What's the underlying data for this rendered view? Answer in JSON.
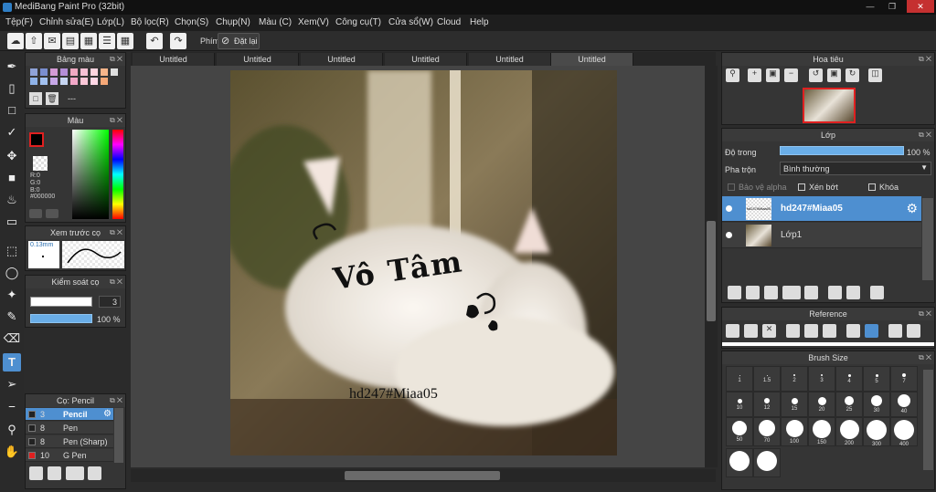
{
  "app": {
    "title": "MediBang Paint Pro (32bit)"
  },
  "menu": [
    "Tệp(F)",
    "Chỉnh sửa(E)",
    "Lớp(L)",
    "Bộ lọc(R)",
    "Chọn(S)",
    "Chụp(N)",
    "Màu (C)",
    "Xem(V)",
    "Công cụ(T)",
    "Cửa sổ(W)",
    "Cloud",
    "Help"
  ],
  "toolbar": {
    "shortcut_label": "Phím",
    "reset_label": "Đặt lại"
  },
  "tabs": [
    "Untitled",
    "Untitled",
    "Untitled",
    "Untitled",
    "Untitled",
    "Untitled"
  ],
  "panels": {
    "palette": {
      "title": "Bảng màu",
      "dash": "---"
    },
    "color": {
      "title": "Màu",
      "r": "R:0",
      "g": "G:0",
      "b": "B:0",
      "hex": "#000000"
    },
    "brush_preview": {
      "title": "Xem trước cọ",
      "size": "0.13mm"
    },
    "brush_control": {
      "title": "Kiểm soát cọ",
      "size_value": "3",
      "opacity_value": "100 %"
    },
    "brush": {
      "title": "Cọ: Pencil"
    },
    "navigator": {
      "title": "Hoa tiêu"
    },
    "layer": {
      "title": "Lớp",
      "opacity_label": "Độ trong",
      "opacity_value": "100 %",
      "blend_label": "Pha trộn",
      "blend_value": "Bình thường",
      "protect_alpha": "Bảo vệ alpha",
      "clipping": "Xén bớt",
      "lock": "Khóa"
    },
    "reference": {
      "title": "Reference"
    },
    "brush_size": {
      "title": "Brush Size"
    }
  },
  "brushes": [
    {
      "size": "3",
      "name": "Pencil",
      "color": "#222222",
      "selected": true
    },
    {
      "size": "8",
      "name": "Pen",
      "color": "#222222",
      "selected": false
    },
    {
      "size": "8",
      "name": "Pen (Sharp)",
      "color": "#222222",
      "selected": false
    },
    {
      "size": "10",
      "name": "G Pen",
      "color": "#e02020",
      "selected": false
    }
  ],
  "layers": [
    {
      "name": "hd247#Miaa05",
      "thumb_text": "hd247#Miaa05",
      "selected": true
    },
    {
      "name": "Lớp1",
      "thumb_text": "",
      "selected": false
    }
  ],
  "brush_sizes": [
    "1",
    "1.5",
    "2",
    "3",
    "4",
    "5",
    "7",
    "10",
    "12",
    "15",
    "20",
    "25",
    "30",
    "40",
    "50",
    "70",
    "100",
    "150",
    "200",
    "300",
    "400",
    "",
    ""
  ],
  "canvas": {
    "title_text": "Vô Tâm",
    "watermark": "hd247#Miaa05"
  },
  "colors": {
    "accent": "#4e8fd0",
    "selected_layer": "#4e8fd0",
    "fg_color": "#000000",
    "bg_color": "#ffffff"
  }
}
